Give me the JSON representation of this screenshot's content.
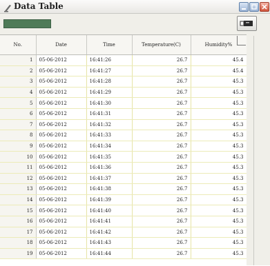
{
  "window": {
    "title": "Data Table",
    "colors": {
      "status_box": "#4f7b58",
      "close_button": "#d0543b",
      "cell_border": "#e6e4a6"
    }
  },
  "toolbar": {
    "export_icon": "usb-drive-icon"
  },
  "table": {
    "headers": [
      "No.",
      "Date",
      "Time",
      "Temperature(C)",
      "Humidity%"
    ],
    "rows": [
      [
        "1",
        "05-06-2012",
        "16:41:26",
        "26.7",
        "45.4"
      ],
      [
        "2",
        "05-06-2012",
        "16:41:27",
        "26.7",
        "45.4"
      ],
      [
        "3",
        "05-06-2012",
        "16:41:28",
        "26.7",
        "45.3"
      ],
      [
        "4",
        "05-06-2012",
        "16:41:29",
        "26.7",
        "45.3"
      ],
      [
        "5",
        "05-06-2012",
        "16:41:30",
        "26.7",
        "45.3"
      ],
      [
        "6",
        "05-06-2012",
        "16:41:31",
        "26.7",
        "45.3"
      ],
      [
        "7",
        "05-06-2012",
        "16:41:32",
        "26.7",
        "45.3"
      ],
      [
        "8",
        "05-06-2012",
        "16:41:33",
        "26.7",
        "45.3"
      ],
      [
        "9",
        "05-06-2012",
        "16:41:34",
        "26.7",
        "45.3"
      ],
      [
        "10",
        "05-06-2012",
        "16:41:35",
        "26.7",
        "45.3"
      ],
      [
        "11",
        "05-06-2012",
        "16:41:36",
        "26.7",
        "45.3"
      ],
      [
        "12",
        "05-06-2012",
        "16:41:37",
        "26.7",
        "45.3"
      ],
      [
        "13",
        "05-06-2012",
        "16:41:38",
        "26.7",
        "45.3"
      ],
      [
        "14",
        "05-06-2012",
        "16:41:39",
        "26.7",
        "45.3"
      ],
      [
        "15",
        "05-06-2012",
        "16:41:40",
        "26.7",
        "45.3"
      ],
      [
        "16",
        "05-06-2012",
        "16:41:41",
        "26.7",
        "45.3"
      ],
      [
        "17",
        "05-06-2012",
        "16:41:42",
        "26.7",
        "45.3"
      ],
      [
        "18",
        "05-06-2012",
        "16:41:43",
        "26.7",
        "45.3"
      ],
      [
        "19",
        "05-06-2012",
        "16:41:44",
        "26.7",
        "45.3"
      ]
    ]
  }
}
